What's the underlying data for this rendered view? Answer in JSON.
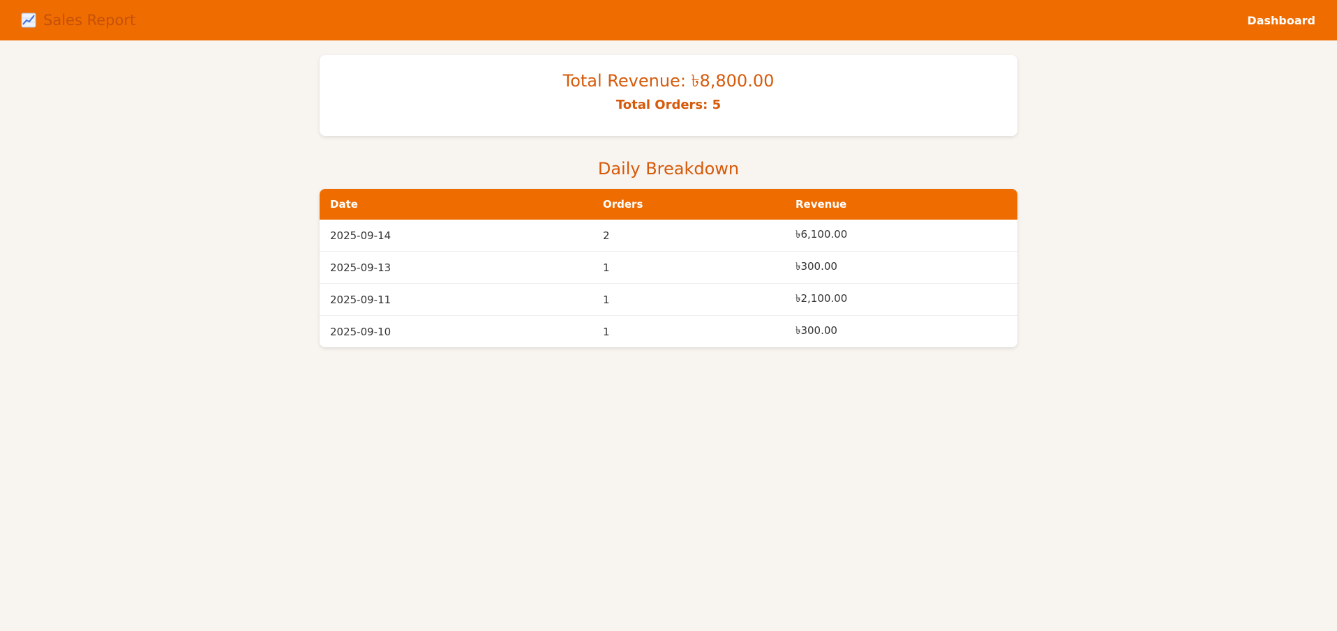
{
  "header": {
    "app_title": "Sales Report",
    "app_icon": "chart-increasing-icon",
    "nav_dashboard": "Dashboard"
  },
  "summary": {
    "total_revenue": "Total Revenue: ৳8,800.00",
    "total_orders": "Total Orders: 5"
  },
  "breakdown": {
    "title": "Daily Breakdown",
    "columns": [
      "Date",
      "Orders",
      "Revenue"
    ],
    "rows": [
      {
        "date": "2025-09-14",
        "orders": "2",
        "revenue": "৳6,100.00"
      },
      {
        "date": "2025-09-13",
        "orders": "1",
        "revenue": "৳300.00"
      },
      {
        "date": "2025-09-11",
        "orders": "1",
        "revenue": "৳2,100.00"
      },
      {
        "date": "2025-09-10",
        "orders": "1",
        "revenue": "৳300.00"
      }
    ]
  },
  "colors": {
    "accent": "#ef6c00",
    "heading": "#d65a0a",
    "background": "#f8f4f0"
  }
}
